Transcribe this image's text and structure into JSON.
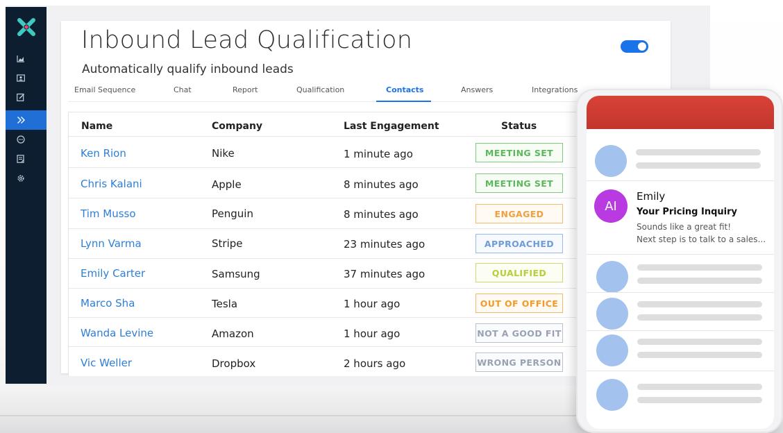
{
  "app": {
    "title": "Inbound Lead Qualification",
    "subtitle": "Automatically qualify inbound leads",
    "auto_qualify_enabled": true
  },
  "sidebar": {
    "items": [
      {
        "icon": "chart-icon"
      },
      {
        "icon": "contact-card-icon"
      },
      {
        "icon": "edit-icon"
      },
      {
        "icon": "double-chevron-right-icon",
        "active": true
      },
      {
        "icon": "chat-bubble-icon"
      },
      {
        "icon": "document-icon"
      },
      {
        "icon": "gear-icon"
      }
    ]
  },
  "tabs": [
    {
      "label": "Email Sequence"
    },
    {
      "label": "Chat"
    },
    {
      "label": "Report"
    },
    {
      "label": "Qualification"
    },
    {
      "label": "Contacts",
      "active": true
    },
    {
      "label": "Answers"
    },
    {
      "label": "Integrations"
    }
  ],
  "table": {
    "headers": {
      "name": "Name",
      "company": "Company",
      "engagement": "Last Engagement",
      "status": "Status"
    },
    "rows": [
      {
        "name": "Ken Rion",
        "company": "Nike",
        "engagement": "1 minute ago",
        "status": "MEETING SET"
      },
      {
        "name": "Chris Kalani",
        "company": "Apple",
        "engagement": "8 minutes ago",
        "status": "MEETING SET"
      },
      {
        "name": "Tim Musso",
        "company": "Penguin",
        "engagement": "8 minutes ago",
        "status": "ENGAGED"
      },
      {
        "name": "Lynn Varma",
        "company": "Stripe",
        "engagement": "23 minutes ago",
        "status": "APPROACHED"
      },
      {
        "name": "Emily Carter",
        "company": "Samsung",
        "engagement": "37 minutes ago",
        "status": "QUALIFIED"
      },
      {
        "name": "Marco Sha",
        "company": "Tesla",
        "engagement": "1 hour ago",
        "status": "OUT OF OFFICE"
      },
      {
        "name": "Wanda Levine",
        "company": "Amazon",
        "engagement": "1 hour ago",
        "status": "NOT A GOOD FIT"
      },
      {
        "name": "Vic Weller",
        "company": "Dropbox",
        "engagement": "2 hours ago",
        "status": "WRONG PERSON"
      }
    ]
  },
  "status_colors": {
    "MEETING SET": {
      "text": "#5cb85c",
      "border": "#7dcc7d",
      "bg": "#f7fcf5"
    },
    "ENGAGED": {
      "text": "#f0a040",
      "border": "#f5b870",
      "bg": "#fffaf2"
    },
    "APPROACHED": {
      "text": "#6f9bd8",
      "border": "#98baea",
      "bg": "#f6f9fe"
    },
    "QUALIFIED": {
      "text": "#b5cf3a",
      "border": "#c9dd6e",
      "bg": "#fcfdf3"
    },
    "OUT OF OFFICE": {
      "text": "#f39a2b",
      "border": "#f7b765",
      "bg": "#fffaf2"
    },
    "NOT A GOOD FIT": {
      "text": "#98a2b3",
      "border": "#b9c1cf",
      "bg": "#fafbfc"
    },
    "WRONG PERSON": {
      "text": "#98a2b3",
      "border": "#b9c1cf",
      "bg": "#fafbfc"
    }
  },
  "phone": {
    "message": {
      "avatar_text": "AI",
      "sender": "Emily",
      "subject": "Your Pricing Inquiry",
      "preview_line1": "Sounds like a great fit!",
      "preview_line2": "Next step is to talk to a sales..."
    }
  },
  "colors": {
    "sidebar_bg": "#0c1e30",
    "accent": "#1a73e8",
    "link": "#2d7fd8",
    "phone_header": "#d23f33",
    "ai_avatar": "#b83ae0"
  }
}
